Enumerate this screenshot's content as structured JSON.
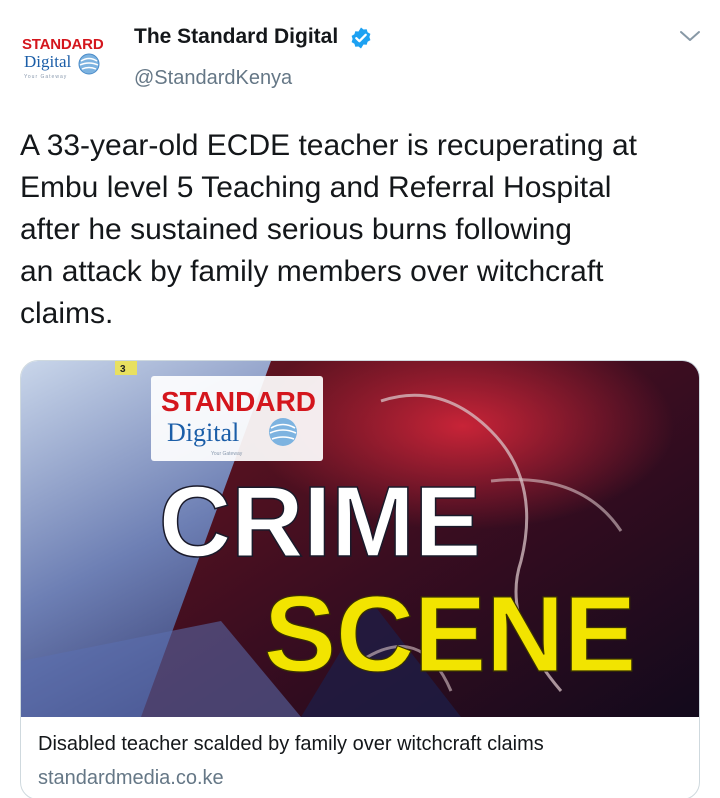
{
  "account": {
    "display_name": "The Standard Digital",
    "handle": "@StandardKenya",
    "avatar": {
      "brand_top": "STANDARD",
      "brand_bottom": "Digital",
      "tagline": "Your Gateway"
    }
  },
  "tweet": {
    "text": "A 33-year-old ECDE teacher is recuperating at\nEmbu level 5 Teaching and Referral Hospital\nafter he sustained serious burns following\nan attack by family members over witchcraft\nclaims."
  },
  "card": {
    "image": {
      "brand_top": "STANDARD",
      "brand_bottom": "Digital",
      "tagline": "Your Gateway",
      "headline_line1": "CRIME",
      "headline_line2": "SCENE"
    },
    "title": "Disabled teacher scalded by family over witchcraft claims",
    "domain": "standardmedia.co.ke"
  },
  "colors": {
    "brand_red": "#d4161d",
    "brand_blue": "#1b5ea8",
    "verified_blue": "#1da1f2",
    "secondary_text": "#657786",
    "headline_yellow": "#f2e400"
  },
  "icons": [
    "verified-icon",
    "chevron-down-icon",
    "globe-icon"
  ]
}
